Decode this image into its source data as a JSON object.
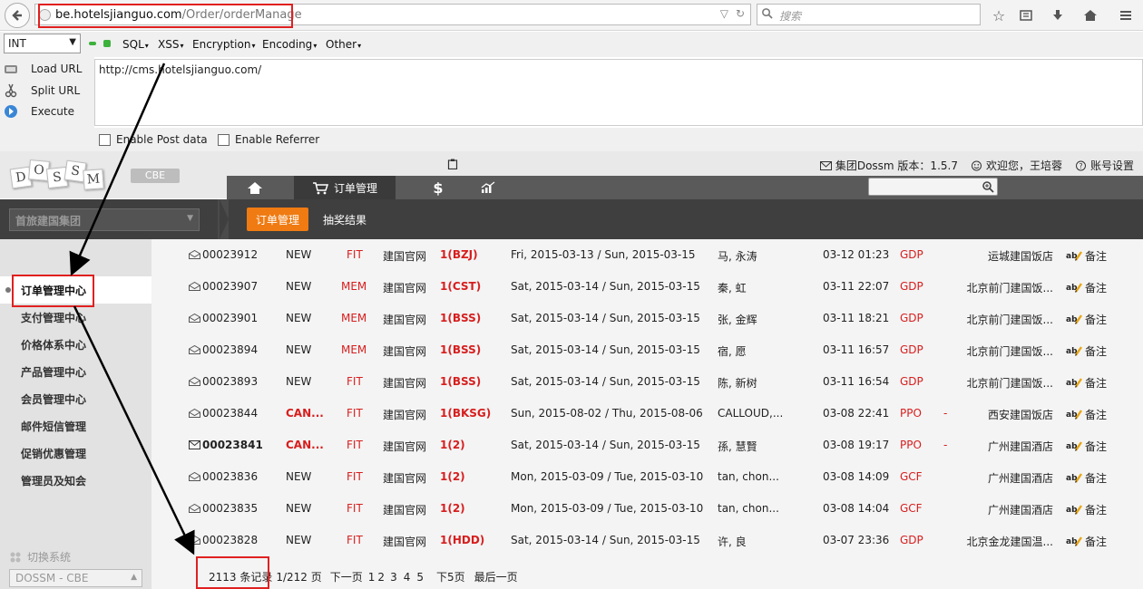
{
  "browser": {
    "url_domain": "be.hotelsjianguo.com",
    "url_path": "/Order/orderManage",
    "search_placeholder": "搜索"
  },
  "hackbar": {
    "type_select": "INT",
    "menus": [
      "SQL",
      "XSS",
      "Encryption",
      "Encoding",
      "Other"
    ],
    "actions": [
      "Load URL",
      "Split URL",
      "Execute"
    ],
    "url_value": "http://cms.hotelsjianguo.com/",
    "enable_post": "Enable Post data",
    "enable_referrer": "Enable Referrer"
  },
  "app": {
    "logo_letters": [
      "D",
      "O",
      "S",
      "S",
      "M"
    ],
    "edition": "CBE",
    "version_text": "集团Dossm 版本：1.5.7",
    "welcome_text": "欢迎您，王培蓉",
    "settings_text": "账号设置",
    "nav_tabs": {
      "orders": "订单管理",
      "money": "$"
    },
    "org_select": "首旅建国集团",
    "sub_tabs": [
      "订单管理",
      "抽奖结果"
    ]
  },
  "sidebar": {
    "items": [
      "订单管理中心",
      "支付管理中心",
      "价格体系中心",
      "产品管理中心",
      "会员管理中心",
      "邮件短信管理",
      "促销优惠管理",
      "管理员及知会"
    ],
    "switch_label": "切换系统",
    "system_select": "DOSSM - CBE"
  },
  "orders": {
    "note_label": "备注",
    "rows": [
      {
        "id": "00023912",
        "status": "NEW",
        "type": "FIT",
        "channel": "建国官网",
        "code": "1(BZJ)",
        "dates": "Fri, 2015-03-13 / Sun, 2015-03-15",
        "guest": "马, 永涛",
        "time": "03-12 01:23",
        "src": "GDP",
        "dash": "",
        "hotel": "运城建国饭店"
      },
      {
        "id": "00023907",
        "status": "NEW",
        "type": "MEM",
        "channel": "建国官网",
        "code": "1(CST)",
        "dates": "Sat, 2015-03-14 / Sun, 2015-03-15",
        "guest": "秦, 虹",
        "time": "03-11 22:07",
        "src": "GDP",
        "dash": "",
        "hotel": "北京前门建国饭..."
      },
      {
        "id": "00023901",
        "status": "NEW",
        "type": "MEM",
        "channel": "建国官网",
        "code": "1(BSS)",
        "dates": "Sat, 2015-03-14 / Sun, 2015-03-15",
        "guest": "张, 金辉",
        "time": "03-11 18:21",
        "src": "GDP",
        "dash": "",
        "hotel": "北京前门建国饭..."
      },
      {
        "id": "00023894",
        "status": "NEW",
        "type": "MEM",
        "channel": "建国官网",
        "code": "1(BSS)",
        "dates": "Sat, 2015-03-14 / Sun, 2015-03-15",
        "guest": "宿, 愿",
        "time": "03-11 16:57",
        "src": "GDP",
        "dash": "",
        "hotel": "北京前门建国饭..."
      },
      {
        "id": "00023893",
        "status": "NEW",
        "type": "FIT",
        "channel": "建国官网",
        "code": "1(BSS)",
        "dates": "Sat, 2015-03-14 / Sun, 2015-03-15",
        "guest": "陈, 新树",
        "time": "03-11 16:54",
        "src": "GDP",
        "dash": "",
        "hotel": "北京前门建国饭..."
      },
      {
        "id": "00023844",
        "status": "CAN...",
        "type": "FIT",
        "channel": "建国官网",
        "code": "1(BKSG)",
        "dates": "Sun, 2015-08-02 / Thu, 2015-08-06",
        "guest": "CALLOUD,...",
        "time": "03-08 22:41",
        "src": "PPO",
        "dash": "-",
        "hotel": "西安建国饭店"
      },
      {
        "id": "00023841",
        "status": "CAN...",
        "type": "FIT",
        "channel": "建国官网",
        "code": "1(2)",
        "dates": "Sat, 2015-03-14 / Sun, 2015-03-15",
        "guest": "孫, 慧賢",
        "time": "03-08 19:17",
        "src": "PPO",
        "dash": "-",
        "hotel": "广州建国酒店"
      },
      {
        "id": "00023836",
        "status": "NEW",
        "type": "FIT",
        "channel": "建国官网",
        "code": "1(2)",
        "dates": "Mon, 2015-03-09 / Tue, 2015-03-10",
        "guest": "tan, chon...",
        "time": "03-08 14:09",
        "src": "GCF",
        "dash": "",
        "hotel": "广州建国酒店"
      },
      {
        "id": "00023835",
        "status": "NEW",
        "type": "FIT",
        "channel": "建国官网",
        "code": "1(2)",
        "dates": "Mon, 2015-03-09 / Tue, 2015-03-10",
        "guest": "tan, chon...",
        "time": "03-08 14:04",
        "src": "GCF",
        "dash": "",
        "hotel": "广州建国酒店"
      },
      {
        "id": "00023828",
        "status": "NEW",
        "type": "FIT",
        "channel": "建国官网",
        "code": "1(HDD)",
        "dates": "Sat, 2015-03-14 / Sun, 2015-03-15",
        "guest": "许, 良",
        "time": "03-07 23:36",
        "src": "GDP",
        "dash": "",
        "hotel": "北京金龙建国温..."
      }
    ]
  },
  "pager": {
    "total": "2113 条记录",
    "page": "1/212 页",
    "next": "下一页",
    "pages": [
      "1",
      "2",
      "3",
      "4",
      "5"
    ],
    "next5": "下5页",
    "last": "最后一页"
  },
  "colors": {
    "accent": "#ef7b12",
    "annotation": "#e02020",
    "danger_text": "#d71e1e"
  }
}
